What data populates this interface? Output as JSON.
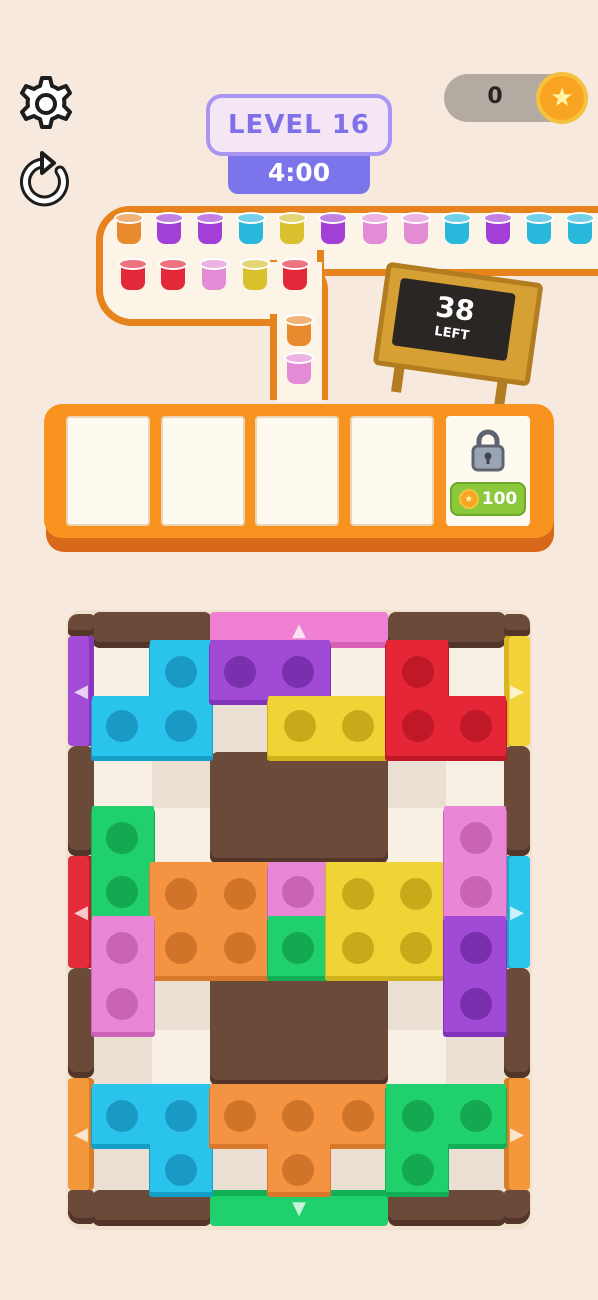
{
  "hud": {
    "settings_icon": "gear-icon",
    "restart_icon": "restart-icon",
    "level_label": "LEVEL 16",
    "timer": "4:00",
    "coins": "0",
    "coin_icon": "star-coin-icon"
  },
  "queue": {
    "remaining_count": "38",
    "remaining_label": "LEFT",
    "colors": {
      "orange": "#e98a2e",
      "purple": "#a23fd6",
      "cyan": "#27b8dc",
      "yellow": "#d8c12c",
      "pink": "#e48bd6",
      "red": "#e3283a"
    },
    "top_row_cups": [
      "orange",
      "purple",
      "purple",
      "cyan",
      "yellow",
      "purple",
      "pink",
      "pink",
      "cyan",
      "purple",
      "cyan",
      "cyan"
    ],
    "second_row_cups": [
      "red",
      "red",
      "pink",
      "yellow",
      "red"
    ],
    "column_cups": [
      "orange",
      "pink"
    ]
  },
  "tray": {
    "empty_slots": 4,
    "lock_icon": "padlock-icon",
    "unlock_cost": "100"
  },
  "board": {
    "gates": [
      {
        "side": "top",
        "color": "#ef7fd0"
      },
      {
        "side": "left",
        "color": "#a44bd8"
      },
      {
        "side": "left",
        "color": "#e52c3b"
      },
      {
        "side": "left",
        "color": "#f4983c"
      },
      {
        "side": "right",
        "color": "#f3d23a"
      },
      {
        "side": "right",
        "color": "#2cc6ec"
      },
      {
        "side": "right",
        "color": "#f4983c"
      },
      {
        "side": "bottom",
        "color": "#1fd06c"
      }
    ],
    "blocks": [
      {
        "name": "cyan-l-block-top-left",
        "color": "cyan",
        "studs": 3
      },
      {
        "name": "purple-bar-top",
        "color": "purple",
        "studs": 2
      },
      {
        "name": "yellow-bar-top",
        "color": "yellow",
        "studs": 2
      },
      {
        "name": "red-l-block-top-right",
        "color": "red",
        "studs": 3
      },
      {
        "name": "green-bar-left",
        "color": "green",
        "studs": 2
      },
      {
        "name": "orange-square-center",
        "color": "orange",
        "studs": 4
      },
      {
        "name": "pink-single-center",
        "color": "pink",
        "studs": 1
      },
      {
        "name": "green-single-center",
        "color": "green",
        "studs": 1
      },
      {
        "name": "yellow-square-center",
        "color": "yellow",
        "studs": 4
      },
      {
        "name": "pink-bar-right",
        "color": "pink",
        "studs": 2
      },
      {
        "name": "pink-bar-left",
        "color": "pink",
        "studs": 2
      },
      {
        "name": "purple-bar-right",
        "color": "purple",
        "studs": 2
      },
      {
        "name": "cyan-l-block-bottom-left",
        "color": "cyan",
        "studs": 3
      },
      {
        "name": "orange-t-block-bottom",
        "color": "orange",
        "studs": 4
      },
      {
        "name": "green-l-block-bottom-right",
        "color": "green",
        "studs": 3
      }
    ]
  }
}
